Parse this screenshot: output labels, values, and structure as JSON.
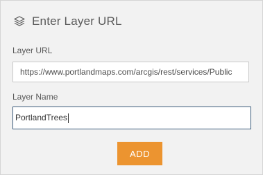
{
  "dialog": {
    "title": "Enter Layer URL",
    "icon": "layers-icon"
  },
  "layer_url": {
    "label": "Layer URL",
    "value": "https://www.portlandmaps.com/arcgis/rest/services/Public"
  },
  "layer_name": {
    "label": "Layer Name",
    "value": "PortlandTrees"
  },
  "actions": {
    "add_label": "ADD"
  },
  "colors": {
    "accent": "#ec9430",
    "panel_background": "#f2f2f2",
    "focus_border": "#3a5a7a"
  }
}
